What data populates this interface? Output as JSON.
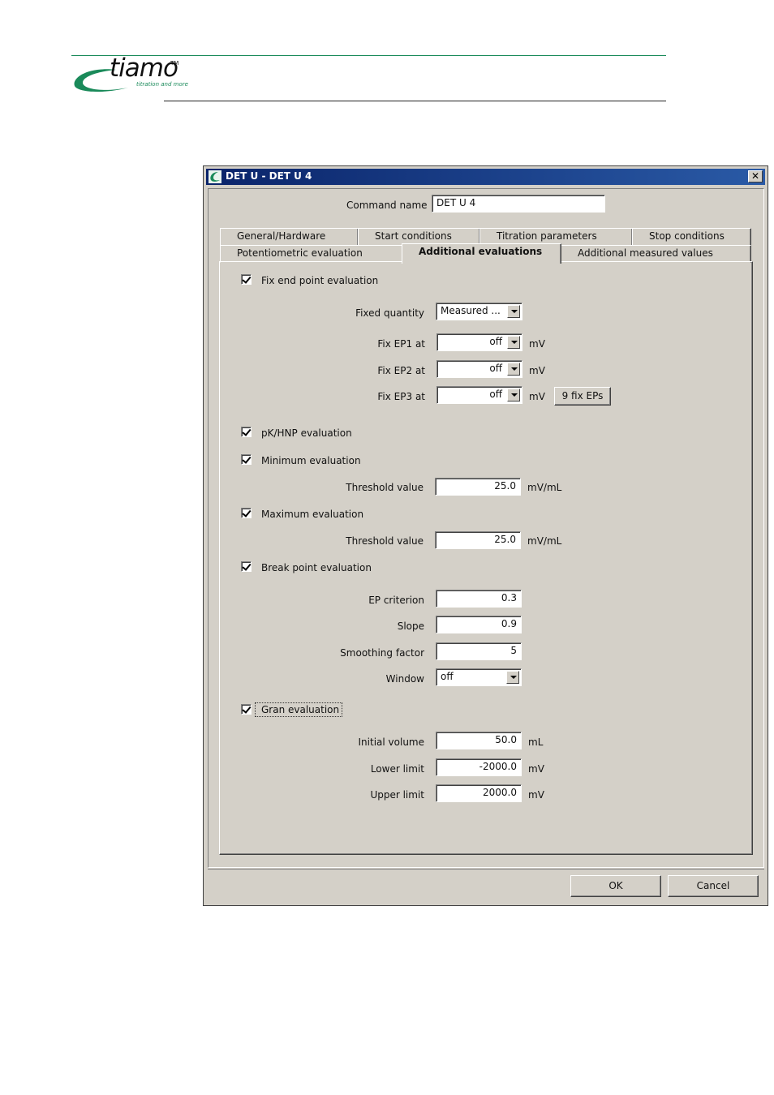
{
  "brand": {
    "name": "tiamo",
    "trademark": "TM",
    "tagline": "titration and more",
    "color": "#1a8a5a"
  },
  "window": {
    "title": "DET U - DET U 4",
    "close_glyph": "✕"
  },
  "command": {
    "label": "Command name",
    "value": "DET U 4"
  },
  "tabs": {
    "row1": [
      "General/Hardware",
      "Start conditions",
      "Titration parameters",
      "Stop conditions"
    ],
    "row2": [
      "Potentiometric evaluation",
      "Additional evaluations",
      "Additional measured values"
    ],
    "active": "Additional evaluations"
  },
  "fix_ep": {
    "label": "Fix end point evaluation",
    "checked": true,
    "fixed_quantity_label": "Fixed quantity",
    "fixed_quantity_value": "Measured ...",
    "ep1_label": "Fix EP1 at",
    "ep1_value": "off",
    "ep2_label": "Fix EP2 at",
    "ep2_value": "off",
    "ep3_label": "Fix EP3 at",
    "ep3_value": "off",
    "unit": "mV",
    "nine_button": "9 fix EPs"
  },
  "pk": {
    "label": "pK/HNP evaluation",
    "checked": true
  },
  "minimum": {
    "label": "Minimum evaluation",
    "checked": true,
    "threshold_label": "Threshold value",
    "threshold_value": "25.0",
    "unit": "mV/mL"
  },
  "maximum": {
    "label": "Maximum evaluation",
    "checked": true,
    "threshold_label": "Threshold value",
    "threshold_value": "25.0",
    "unit": "mV/mL"
  },
  "breakpoint": {
    "label": "Break point evaluation",
    "checked": true,
    "ep_criterion_label": "EP criterion",
    "ep_criterion_value": "0.3",
    "slope_label": "Slope",
    "slope_value": "0.9",
    "smoothing_label": "Smoothing factor",
    "smoothing_value": "5",
    "window_label": "Window",
    "window_value": "off"
  },
  "gran": {
    "label": "Gran evaluation",
    "checked": true,
    "initial_volume_label": "Initial volume",
    "initial_volume_value": "50.0",
    "initial_volume_unit": "mL",
    "lower_limit_label": "Lower limit",
    "lower_limit_value": "-2000.0",
    "lower_limit_unit": "mV",
    "upper_limit_label": "Upper limit",
    "upper_limit_value": "2000.0",
    "upper_limit_unit": "mV"
  },
  "buttons": {
    "ok": "OK",
    "cancel": "Cancel"
  }
}
